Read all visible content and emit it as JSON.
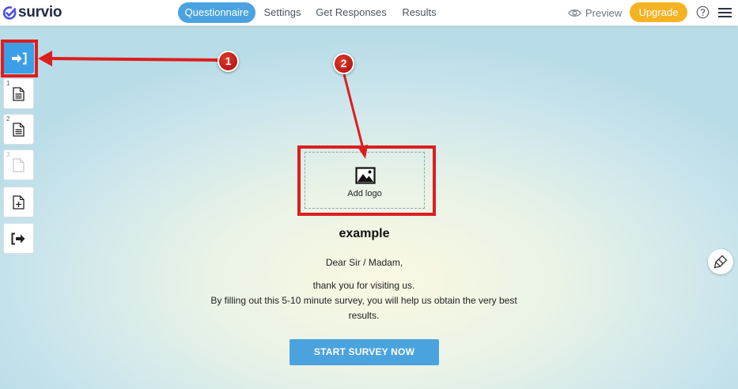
{
  "app": {
    "name": "survio",
    "brand_color": "#1f2a44",
    "accent": "#4aa3df",
    "upgrade_color": "#f5b324"
  },
  "nav": {
    "tabs": [
      {
        "label": "Questionnaire",
        "active": true
      },
      {
        "label": "Settings",
        "active": false
      },
      {
        "label": "Get Responses",
        "active": false
      },
      {
        "label": "Results",
        "active": false
      }
    ],
    "preview_label": "Preview",
    "upgrade_label": "Upgrade",
    "help_icon": "question-circle-icon",
    "menu_icon": "hamburger-menu-icon"
  },
  "sidebar": {
    "pages": [
      {
        "type": "intro",
        "icon": "enter-page-icon",
        "active": true
      },
      {
        "number": "1",
        "icon": "document-icon"
      },
      {
        "number": "2",
        "icon": "document-icon"
      },
      {
        "number": "3",
        "icon": "blank-document-icon",
        "dim": true
      },
      {
        "type": "add",
        "icon": "add-page-icon"
      },
      {
        "type": "end",
        "icon": "exit-page-icon"
      }
    ]
  },
  "survey": {
    "logo_placeholder": "Add logo",
    "title": "example",
    "greeting": "Dear Sir / Madam,",
    "intro_lines": [
      "thank you for visiting us.",
      "By filling out this 5-10 minute survey, you will help us obtain the very best results."
    ],
    "start_button": "START SURVEY NOW"
  },
  "annotations": {
    "badges": [
      "1",
      "2"
    ],
    "color": "#dd1e1e"
  }
}
